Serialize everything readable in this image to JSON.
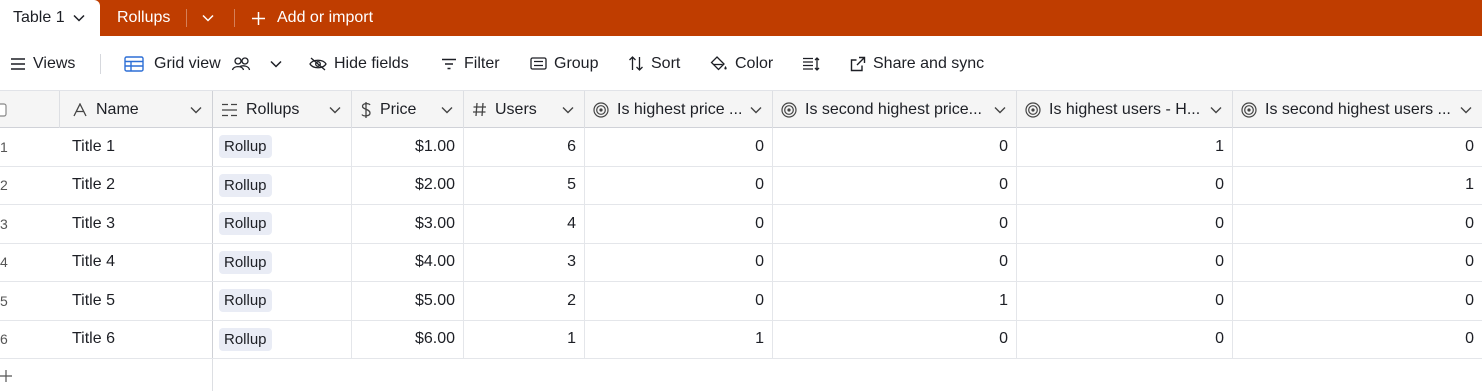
{
  "tabs": {
    "active": "Table 1",
    "other": "Rollups",
    "add": "Add or import"
  },
  "toolbar": {
    "views": "Views",
    "grid_view": "Grid view",
    "hide_fields": "Hide fields",
    "filter": "Filter",
    "group": "Group",
    "sort": "Sort",
    "color": "Color",
    "share": "Share and sync"
  },
  "columns": [
    {
      "label": "Name",
      "icon": "text-icon"
    },
    {
      "label": "Rollups",
      "icon": "link-icon"
    },
    {
      "label": "Price",
      "icon": "currency-icon"
    },
    {
      "label": "Users",
      "icon": "number-icon"
    },
    {
      "label": "Is highest price ...",
      "icon": "formula-icon"
    },
    {
      "label": "Is second highest price...",
      "icon": "formula-icon"
    },
    {
      "label": "Is highest users - H...",
      "icon": "formula-icon"
    },
    {
      "label": "Is second highest users ...",
      "icon": "formula-icon"
    }
  ],
  "rows": [
    {
      "num": "1",
      "name": "Title 1",
      "rollup": "Rollup",
      "price": "$1.00",
      "users": "6",
      "c1": "0",
      "c2": "0",
      "c3": "1",
      "c4": "0"
    },
    {
      "num": "2",
      "name": "Title 2",
      "rollup": "Rollup",
      "price": "$2.00",
      "users": "5",
      "c1": "0",
      "c2": "0",
      "c3": "0",
      "c4": "1"
    },
    {
      "num": "3",
      "name": "Title 3",
      "rollup": "Rollup",
      "price": "$3.00",
      "users": "4",
      "c1": "0",
      "c2": "0",
      "c3": "0",
      "c4": "0"
    },
    {
      "num": "4",
      "name": "Title 4",
      "rollup": "Rollup",
      "price": "$4.00",
      "users": "3",
      "c1": "0",
      "c2": "0",
      "c3": "0",
      "c4": "0"
    },
    {
      "num": "5",
      "name": "Title 5",
      "rollup": "Rollup",
      "price": "$5.00",
      "users": "2",
      "c1": "0",
      "c2": "1",
      "c3": "0",
      "c4": "0"
    },
    {
      "num": "6",
      "name": "Title 6",
      "rollup": "Rollup",
      "price": "$6.00",
      "users": "1",
      "c1": "1",
      "c2": "0",
      "c3": "0",
      "c4": "0"
    }
  ],
  "colors": {
    "brand": "#bf3d00",
    "chip": "#e9ecf5"
  }
}
